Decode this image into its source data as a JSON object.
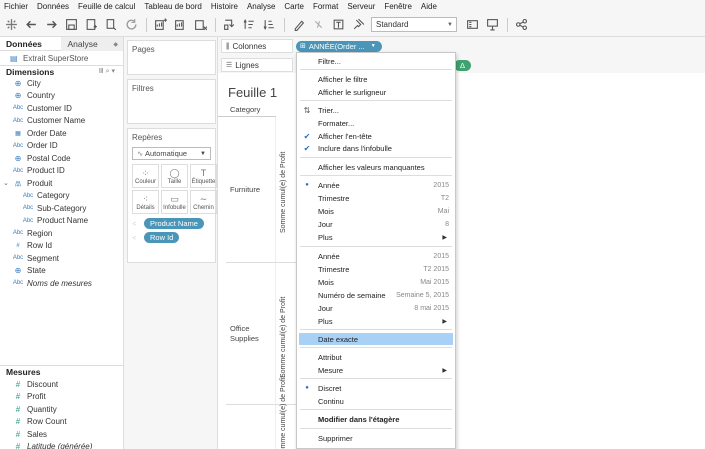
{
  "menubar": [
    "Fichier",
    "Données",
    "Feuille de calcul",
    "Tableau de bord",
    "Histoire",
    "Analyse",
    "Carte",
    "Format",
    "Serveur",
    "Fenêtre",
    "Aide"
  ],
  "toolbar": {
    "fit_select": "Standard"
  },
  "left_pane": {
    "tab_data": "Données",
    "tab_analysis": "Analyse",
    "datasource": "Extrait SuperStore",
    "dimensions_title": "Dimensions",
    "dimensions": [
      {
        "label": "City",
        "type": "geo"
      },
      {
        "label": "Country",
        "type": "geo"
      },
      {
        "label": "Customer ID",
        "type": "abc"
      },
      {
        "label": "Customer Name",
        "type": "abc"
      },
      {
        "label": "Order Date",
        "type": "date"
      },
      {
        "label": "Order ID",
        "type": "abc"
      },
      {
        "label": "Postal Code",
        "type": "geo"
      },
      {
        "label": "Product ID",
        "type": "abc"
      },
      {
        "label": "Produit",
        "type": "hier"
      },
      {
        "label": "Category",
        "type": "abc"
      },
      {
        "label": "Sub-Category",
        "type": "abc"
      },
      {
        "label": "Product Name",
        "type": "abc"
      },
      {
        "label": "Region",
        "type": "abc"
      },
      {
        "label": "Row Id",
        "type": "num"
      },
      {
        "label": "Segment",
        "type": "abc"
      },
      {
        "label": "State",
        "type": "geo"
      },
      {
        "label": "Noms de mesures",
        "type": "abc"
      }
    ],
    "measures_title": "Mesures",
    "measures": [
      "Discount",
      "Profit",
      "Quantity",
      "Row Count",
      "Sales",
      "Latitude (générée)"
    ]
  },
  "cards": {
    "pages": "Pages",
    "filters": "Filtres",
    "marks": "Repères",
    "marks_type": "Automatique",
    "marks_buttons": [
      {
        "label": "Couleur",
        "icon": "color-icon"
      },
      {
        "label": "Taille",
        "icon": "size-icon"
      },
      {
        "label": "Étiquette",
        "icon": "label-icon"
      },
      {
        "label": "Détails",
        "icon": "detail-icon"
      },
      {
        "label": "Infobulle",
        "icon": "tooltip-icon"
      },
      {
        "label": "Chemin",
        "icon": "path-icon"
      }
    ],
    "marks_pills": [
      "Product Name",
      "Row Id"
    ]
  },
  "shelves": {
    "columns_label": "Colonnes",
    "columns_pill": "ANNÉE(Order ...",
    "rows_label": "Lignes",
    "rows_pill_symbol": "Δ"
  },
  "sheet": {
    "title": "Feuille 1",
    "category_header": "Category",
    "categories": [
      "Furniture",
      "Office Supplies"
    ],
    "axis_label": "Somme cumul(e) de Profit"
  },
  "context_menu": {
    "items": [
      {
        "label": "Filtre...",
        "mark": "",
        "right": "",
        "arrow": false
      },
      {
        "label": "Afficher le filtre",
        "mark": "",
        "right": "",
        "arrow": false
      },
      {
        "label": "Afficher le surligneur",
        "mark": "",
        "right": "",
        "arrow": false
      },
      {
        "label": "Trier...",
        "mark": "sort",
        "right": "",
        "arrow": false
      },
      {
        "label": "Formater...",
        "mark": "",
        "right": "",
        "arrow": false
      },
      {
        "label": "Afficher l'en-tête",
        "mark": "check",
        "right": "",
        "arrow": false
      },
      {
        "label": "Inclure dans l'infobulle",
        "mark": "check",
        "right": "",
        "arrow": false
      },
      {
        "label": "Afficher les valeurs manquantes",
        "mark": "",
        "right": "",
        "arrow": false
      },
      {
        "label": "Année",
        "mark": "dot",
        "right": "2015",
        "arrow": false
      },
      {
        "label": "Trimestre",
        "mark": "",
        "right": "T2",
        "arrow": false
      },
      {
        "label": "Mois",
        "mark": "",
        "right": "Mai",
        "arrow": false
      },
      {
        "label": "Jour",
        "mark": "",
        "right": "8",
        "arrow": false
      },
      {
        "label": "Plus",
        "mark": "",
        "right": "",
        "arrow": true
      },
      {
        "label": "Année",
        "mark": "",
        "right": "2015",
        "arrow": false
      },
      {
        "label": "Trimestre",
        "mark": "",
        "right": "T2 2015",
        "arrow": false
      },
      {
        "label": "Mois",
        "mark": "",
        "right": "Mai 2015",
        "arrow": false
      },
      {
        "label": "Numéro de semaine",
        "mark": "",
        "right": "Semaine 5, 2015",
        "arrow": false
      },
      {
        "label": "Jour",
        "mark": "",
        "right": "8 mai 2015",
        "arrow": false
      },
      {
        "label": "Plus",
        "mark": "",
        "right": "",
        "arrow": true
      },
      {
        "label": "Date exacte",
        "mark": "",
        "right": "",
        "arrow": false,
        "highlighted": true
      },
      {
        "label": "Attribut",
        "mark": "",
        "right": "",
        "arrow": false
      },
      {
        "label": "Mesure",
        "mark": "",
        "right": "",
        "arrow": true
      },
      {
        "label": "Discret",
        "mark": "dot",
        "right": "",
        "arrow": false
      },
      {
        "label": "Continu",
        "mark": "",
        "right": "",
        "arrow": false
      },
      {
        "label": "Modifier dans l'étagère",
        "mark": "",
        "right": "",
        "arrow": false,
        "bold": true
      },
      {
        "label": "Supprimer",
        "mark": "",
        "right": "",
        "arrow": false
      }
    ]
  },
  "colors": {
    "pill_blue": "#4a96b8",
    "pill_green": "#3fa36f",
    "highlight": "#a9d1f5"
  }
}
